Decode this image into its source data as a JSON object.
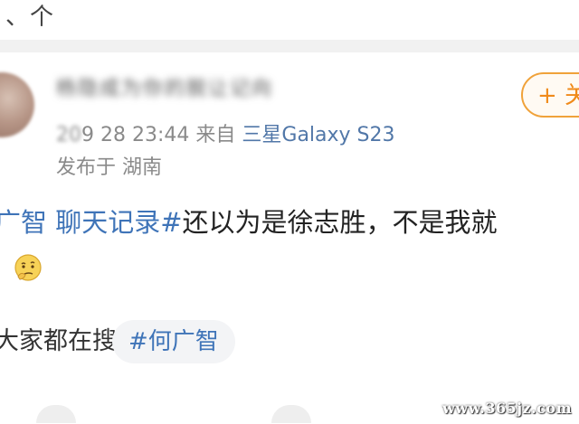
{
  "top_fragment": "、个",
  "post": {
    "username": "杨隐成为你的脱让记向",
    "date_prefix": "20",
    "date": "9 28 23:44",
    "source_label": "来自",
    "device": "三星Galaxy S23",
    "location": "发布于 湖南",
    "follow_label": "+ 关",
    "content": {
      "hashtag_prefix": "广智 聊天记录#",
      "text": "还以为是徐志胜，不是我就"
    },
    "emoji": "thinking-face-emoji"
  },
  "hot_search": {
    "label": "大家都在搜",
    "tag": "#何广智"
  },
  "watermark": "www.365jz.com",
  "colors": {
    "link": "#3f74b8",
    "device_link": "#5177a8",
    "follow_orange": "#f08a1a",
    "meta_gray": "#8a8a8a"
  }
}
